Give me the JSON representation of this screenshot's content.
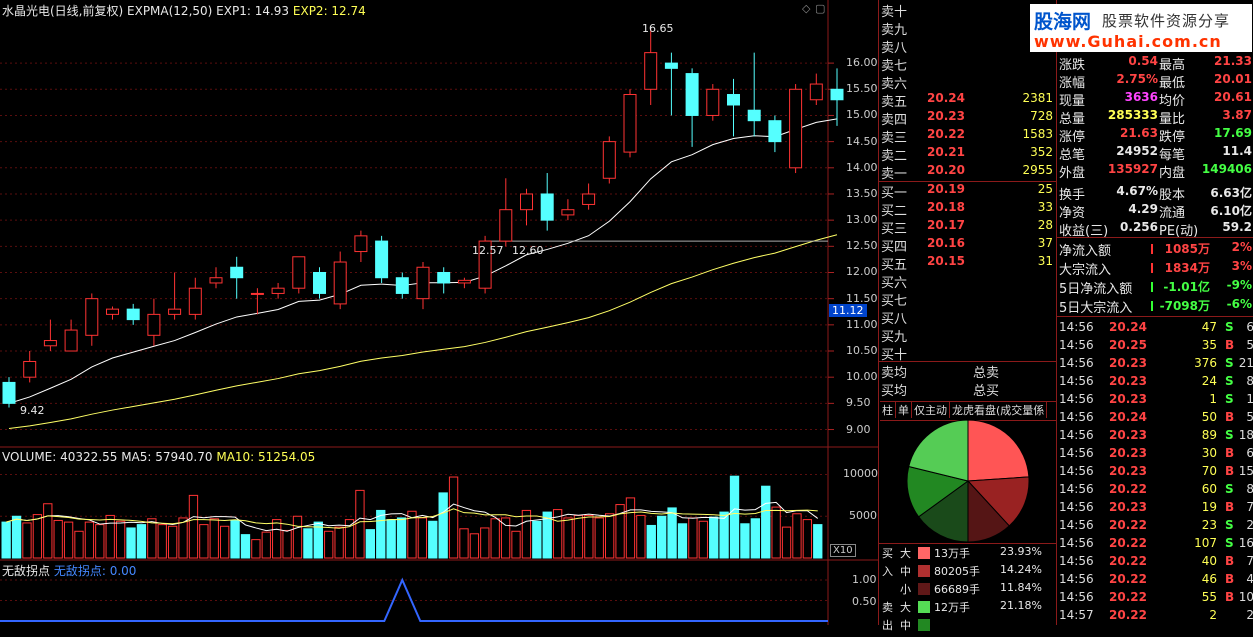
{
  "chart": {
    "title_parts": {
      "name": "水晶光电(日线,前复权)",
      "indicator": "EXPMA(12,50)",
      "exp1": "EXP1: 14.93",
      "exp2": "EXP2: 12.74"
    },
    "high_label": "16.65",
    "low_label": "9.42",
    "mid_labels": [
      "12.57",
      "12.60"
    ],
    "current_price": "11.12",
    "y_ticks": [
      "16.00",
      "15.50",
      "15.00",
      "14.50",
      "14.00",
      "13.50",
      "13.00",
      "12.50",
      "12.00",
      "11.50",
      "11.00",
      "10.50",
      "10.00",
      "9.50",
      "9.00"
    ],
    "y_min": 8.8,
    "y_max": 16.9,
    "candles": [
      {
        "o": 9.9,
        "c": 9.5,
        "h": 10.0,
        "l": 9.42
      },
      {
        "o": 10.0,
        "c": 10.3,
        "h": 10.5,
        "l": 9.9
      },
      {
        "o": 10.6,
        "c": 10.7,
        "h": 11.1,
        "l": 10.5
      },
      {
        "o": 10.5,
        "c": 10.9,
        "h": 11.1,
        "l": 10.5
      },
      {
        "o": 10.8,
        "c": 11.5,
        "h": 11.6,
        "l": 10.6
      },
      {
        "o": 11.2,
        "c": 11.3,
        "h": 11.35,
        "l": 11.1
      },
      {
        "o": 11.3,
        "c": 11.1,
        "h": 11.4,
        "l": 11.0
      },
      {
        "o": 10.8,
        "c": 11.2,
        "h": 11.5,
        "l": 10.6
      },
      {
        "o": 11.2,
        "c": 11.3,
        "h": 12.0,
        "l": 11.1
      },
      {
        "o": 11.2,
        "c": 11.7,
        "h": 11.9,
        "l": 11.1
      },
      {
        "o": 11.8,
        "c": 11.9,
        "h": 12.1,
        "l": 11.7
      },
      {
        "o": 12.1,
        "c": 11.9,
        "h": 12.3,
        "l": 11.5
      },
      {
        "o": 11.6,
        "c": 11.6,
        "h": 11.7,
        "l": 11.2
      },
      {
        "o": 11.6,
        "c": 11.7,
        "h": 11.8,
        "l": 11.5
      },
      {
        "o": 11.7,
        "c": 12.3,
        "h": 12.3,
        "l": 11.6
      },
      {
        "o": 12.0,
        "c": 11.6,
        "h": 12.1,
        "l": 11.5
      },
      {
        "o": 11.4,
        "c": 12.2,
        "h": 12.4,
        "l": 11.3
      },
      {
        "o": 12.4,
        "c": 12.7,
        "h": 12.8,
        "l": 12.2
      },
      {
        "o": 12.6,
        "c": 11.9,
        "h": 12.7,
        "l": 11.8
      },
      {
        "o": 11.9,
        "c": 11.6,
        "h": 12.0,
        "l": 11.5
      },
      {
        "o": 11.5,
        "c": 12.1,
        "h": 12.2,
        "l": 11.3
      },
      {
        "o": 12.0,
        "c": 11.8,
        "h": 12.1,
        "l": 11.6
      },
      {
        "o": 11.8,
        "c": 11.85,
        "h": 11.9,
        "l": 11.7
      },
      {
        "o": 11.7,
        "c": 12.6,
        "h": 12.7,
        "l": 11.6
      },
      {
        "o": 12.6,
        "c": 13.2,
        "h": 13.8,
        "l": 12.5
      },
      {
        "o": 13.2,
        "c": 13.5,
        "h": 13.6,
        "l": 12.9
      },
      {
        "o": 13.5,
        "c": 13.0,
        "h": 13.9,
        "l": 12.8
      },
      {
        "o": 13.1,
        "c": 13.2,
        "h": 13.4,
        "l": 13.0
      },
      {
        "o": 13.3,
        "c": 13.5,
        "h": 13.7,
        "l": 13.2
      },
      {
        "o": 13.8,
        "c": 14.5,
        "h": 14.6,
        "l": 13.7
      },
      {
        "o": 14.3,
        "c": 15.4,
        "h": 15.5,
        "l": 14.2
      },
      {
        "o": 15.5,
        "c": 16.2,
        "h": 16.65,
        "l": 15.2
      },
      {
        "o": 16.0,
        "c": 15.9,
        "h": 16.2,
        "l": 15.0
      },
      {
        "o": 15.8,
        "c": 15.0,
        "h": 15.9,
        "l": 14.4
      },
      {
        "o": 15.0,
        "c": 15.5,
        "h": 15.6,
        "l": 14.9
      },
      {
        "o": 15.4,
        "c": 15.2,
        "h": 15.7,
        "l": 14.6
      },
      {
        "o": 15.1,
        "c": 14.9,
        "h": 16.2,
        "l": 14.6
      },
      {
        "o": 14.9,
        "c": 14.5,
        "h": 15.0,
        "l": 14.3
      },
      {
        "o": 14.0,
        "c": 15.5,
        "h": 15.6,
        "l": 13.9
      },
      {
        "o": 15.3,
        "c": 15.6,
        "h": 15.8,
        "l": 15.2
      },
      {
        "o": 15.5,
        "c": 15.3,
        "h": 15.9,
        "l": 14.8
      }
    ],
    "volume": {
      "title_parts": {
        "vol": "VOLUME: 40322.55",
        "ma5": "MA5: 57940.70",
        "ma10": "MA10: 51254.05"
      },
      "y_ticks": [
        "10000",
        "5000"
      ],
      "unit_label": "X10",
      "values": [
        4300,
        5000,
        4200,
        5200,
        6500,
        4500,
        4300,
        3200,
        4300,
        4000,
        5100,
        4400,
        3600,
        4000,
        4700,
        4000,
        3800,
        4800,
        7500,
        4000,
        4700,
        3800,
        4500,
        2800,
        2200,
        3100,
        4600,
        3300,
        5000,
        3500,
        4300,
        3200,
        3700,
        4600,
        8100,
        3400,
        5700,
        4600,
        4800,
        5600,
        4800,
        4400,
        7800,
        9700,
        3500,
        2900,
        3600,
        4700,
        4800,
        3200,
        5700,
        4400,
        5500,
        5800,
        4800,
        5100,
        5100,
        4800,
        5300,
        6400,
        7200,
        5100,
        3900,
        5000,
        6000,
        4100,
        4800,
        4400,
        4900,
        5500,
        9800,
        4100,
        4700,
        8600,
        6100,
        3700,
        5300,
        4600,
        4000
      ]
    },
    "indicator": {
      "title_parts": {
        "name": "无敌拐点",
        "label": "无敌拐点: 0.00"
      },
      "y_ticks": [
        "1.00",
        "0.50"
      ]
    }
  },
  "book": {
    "sells": [
      {
        "label": "卖十",
        "price": "",
        "vol": ""
      },
      {
        "label": "卖九",
        "price": "",
        "vol": ""
      },
      {
        "label": "卖八",
        "price": "",
        "vol": ""
      },
      {
        "label": "卖七",
        "price": "",
        "vol": ""
      },
      {
        "label": "卖六",
        "price": "",
        "vol": ""
      },
      {
        "label": "卖五",
        "price": "20.24",
        "vol": "2381"
      },
      {
        "label": "卖四",
        "price": "20.23",
        "vol": "728"
      },
      {
        "label": "卖三",
        "price": "20.22",
        "vol": "1583"
      },
      {
        "label": "卖二",
        "price": "20.21",
        "vol": "352"
      },
      {
        "label": "卖一",
        "price": "20.20",
        "vol": "2955"
      }
    ],
    "buys": [
      {
        "label": "买一",
        "price": "20.19",
        "vol": "25"
      },
      {
        "label": "买二",
        "price": "20.18",
        "vol": "33"
      },
      {
        "label": "买三",
        "price": "20.17",
        "vol": "28"
      },
      {
        "label": "买四",
        "price": "20.16",
        "vol": "37"
      },
      {
        "label": "买五",
        "price": "20.15",
        "vol": "31"
      },
      {
        "label": "买六",
        "price": "",
        "vol": ""
      },
      {
        "label": "买七",
        "price": "",
        "vol": ""
      },
      {
        "label": "买八",
        "price": "",
        "vol": ""
      },
      {
        "label": "买九",
        "price": "",
        "vol": ""
      },
      {
        "label": "买十",
        "price": "",
        "vol": ""
      }
    ],
    "avg": [
      {
        "label": "卖均",
        "total": "总卖"
      },
      {
        "label": "买均",
        "total": "总买"
      }
    ],
    "tabs": [
      "柱",
      "单",
      "仅主动",
      "龙虎看盘(成交量係"
    ],
    "flow": [
      {
        "side": "买",
        "size": "大",
        "color": "#ff6666",
        "vol": "13万手",
        "pct": "23.93%"
      },
      {
        "side": "入",
        "size": "中",
        "color": "#b03030",
        "vol": "80205手",
        "pct": "14.24%"
      },
      {
        "side": "",
        "size": "小",
        "color": "#601818",
        "vol": "66689手",
        "pct": "11.84%"
      },
      {
        "side": "卖",
        "size": "大",
        "color": "#55dd55",
        "vol": "12万手",
        "pct": "21.18%"
      },
      {
        "side": "出",
        "size": "中",
        "color": "#228822",
        "vol": "",
        "pct": ""
      }
    ],
    "pie": [
      {
        "pct": 23.93,
        "color": "#ff5555"
      },
      {
        "pct": 14.24,
        "color": "#992222"
      },
      {
        "pct": 11.84,
        "color": "#551515"
      },
      {
        "pct": 15.0,
        "color": "#1a4a1a"
      },
      {
        "pct": 13.81,
        "color": "#228822"
      },
      {
        "pct": 21.18,
        "color": "#55cc55"
      }
    ]
  },
  "quote": {
    "logo": {
      "name": "股海网",
      "slogan": "股票软件资源分享",
      "url": "www.Guhai.com.cn"
    },
    "rows": [
      {
        "l1": "涨跌",
        "v1": "0.54",
        "c1": "red",
        "l2": "最高",
        "v2": "21.33",
        "c2": "red"
      },
      {
        "l1": "涨幅",
        "v1": "2.75%",
        "c1": "red",
        "l2": "最低",
        "v2": "20.01",
        "c2": "red"
      },
      {
        "l1": "现量",
        "v1": "3636",
        "c1": "mag",
        "l2": "均价",
        "v2": "20.61",
        "c2": "red"
      },
      {
        "l1": "总量",
        "v1": "285333",
        "c1": "yellow",
        "l2": "量比",
        "v2": "3.87",
        "c2": "red"
      },
      {
        "l1": "涨停",
        "v1": "21.63",
        "c1": "red",
        "l2": "跌停",
        "v2": "17.69",
        "c2": "green"
      },
      {
        "l1": "总笔",
        "v1": "24952",
        "c1": "white",
        "l2": "每笔",
        "v2": "11.4",
        "c2": "white"
      },
      {
        "l1": "外盘",
        "v1": "135927",
        "c1": "red",
        "l2": "内盘",
        "v2": "149406",
        "c2": "green"
      },
      {
        "l1": "换手",
        "v1": "4.67%",
        "c1": "white",
        "l2": "股本",
        "v2": "6.63亿",
        "c2": "white"
      },
      {
        "l1": "净资",
        "v1": "4.29",
        "c1": "white",
        "l2": "流通",
        "v2": "6.10亿",
        "c2": "white"
      },
      {
        "l1": "收益(三)",
        "v1": "0.256",
        "c1": "white",
        "l2": "PE(动)",
        "v2": "59.2",
        "c2": "white"
      }
    ],
    "money": [
      {
        "label": "净流入额",
        "val": "1085万",
        "pct": "2%",
        "c": "red"
      },
      {
        "label": "大宗流入",
        "val": "1834万",
        "pct": "3%",
        "c": "red"
      },
      {
        "label": "5日净流入额",
        "val": "-1.01亿",
        "pct": "-9%",
        "c": "green"
      },
      {
        "label": "5日大宗流入",
        "val": "-7098万",
        "pct": "-6%",
        "c": "green"
      }
    ],
    "ticks": [
      {
        "t": "14:56",
        "p": "20.24",
        "v": "47",
        "bs": "S",
        "n": "6"
      },
      {
        "t": "14:56",
        "p": "20.25",
        "v": "35",
        "bs": "B",
        "n": "5"
      },
      {
        "t": "14:56",
        "p": "20.23",
        "v": "376",
        "bs": "S",
        "n": "21"
      },
      {
        "t": "14:56",
        "p": "20.23",
        "v": "24",
        "bs": "S",
        "n": "8"
      },
      {
        "t": "14:56",
        "p": "20.23",
        "v": "1",
        "bs": "S",
        "n": "1"
      },
      {
        "t": "14:56",
        "p": "20.24",
        "v": "50",
        "bs": "B",
        "n": "5"
      },
      {
        "t": "14:56",
        "p": "20.23",
        "v": "89",
        "bs": "S",
        "n": "18"
      },
      {
        "t": "14:56",
        "p": "20.23",
        "v": "30",
        "bs": "B",
        "n": "6"
      },
      {
        "t": "14:56",
        "p": "20.23",
        "v": "70",
        "bs": "B",
        "n": "15"
      },
      {
        "t": "14:56",
        "p": "20.22",
        "v": "60",
        "bs": "S",
        "n": "8"
      },
      {
        "t": "14:56",
        "p": "20.23",
        "v": "19",
        "bs": "B",
        "n": "7"
      },
      {
        "t": "14:56",
        "p": "20.22",
        "v": "23",
        "bs": "S",
        "n": "2"
      },
      {
        "t": "14:56",
        "p": "20.22",
        "v": "107",
        "bs": "S",
        "n": "16"
      },
      {
        "t": "14:56",
        "p": "20.22",
        "v": "40",
        "bs": "B",
        "n": "7"
      },
      {
        "t": "14:56",
        "p": "20.22",
        "v": "46",
        "bs": "B",
        "n": "4"
      },
      {
        "t": "14:56",
        "p": "20.22",
        "v": "55",
        "bs": "B",
        "n": "10"
      },
      {
        "t": "14:57",
        "p": "20.22",
        "v": "2",
        "bs": "",
        "n": "2"
      }
    ]
  }
}
